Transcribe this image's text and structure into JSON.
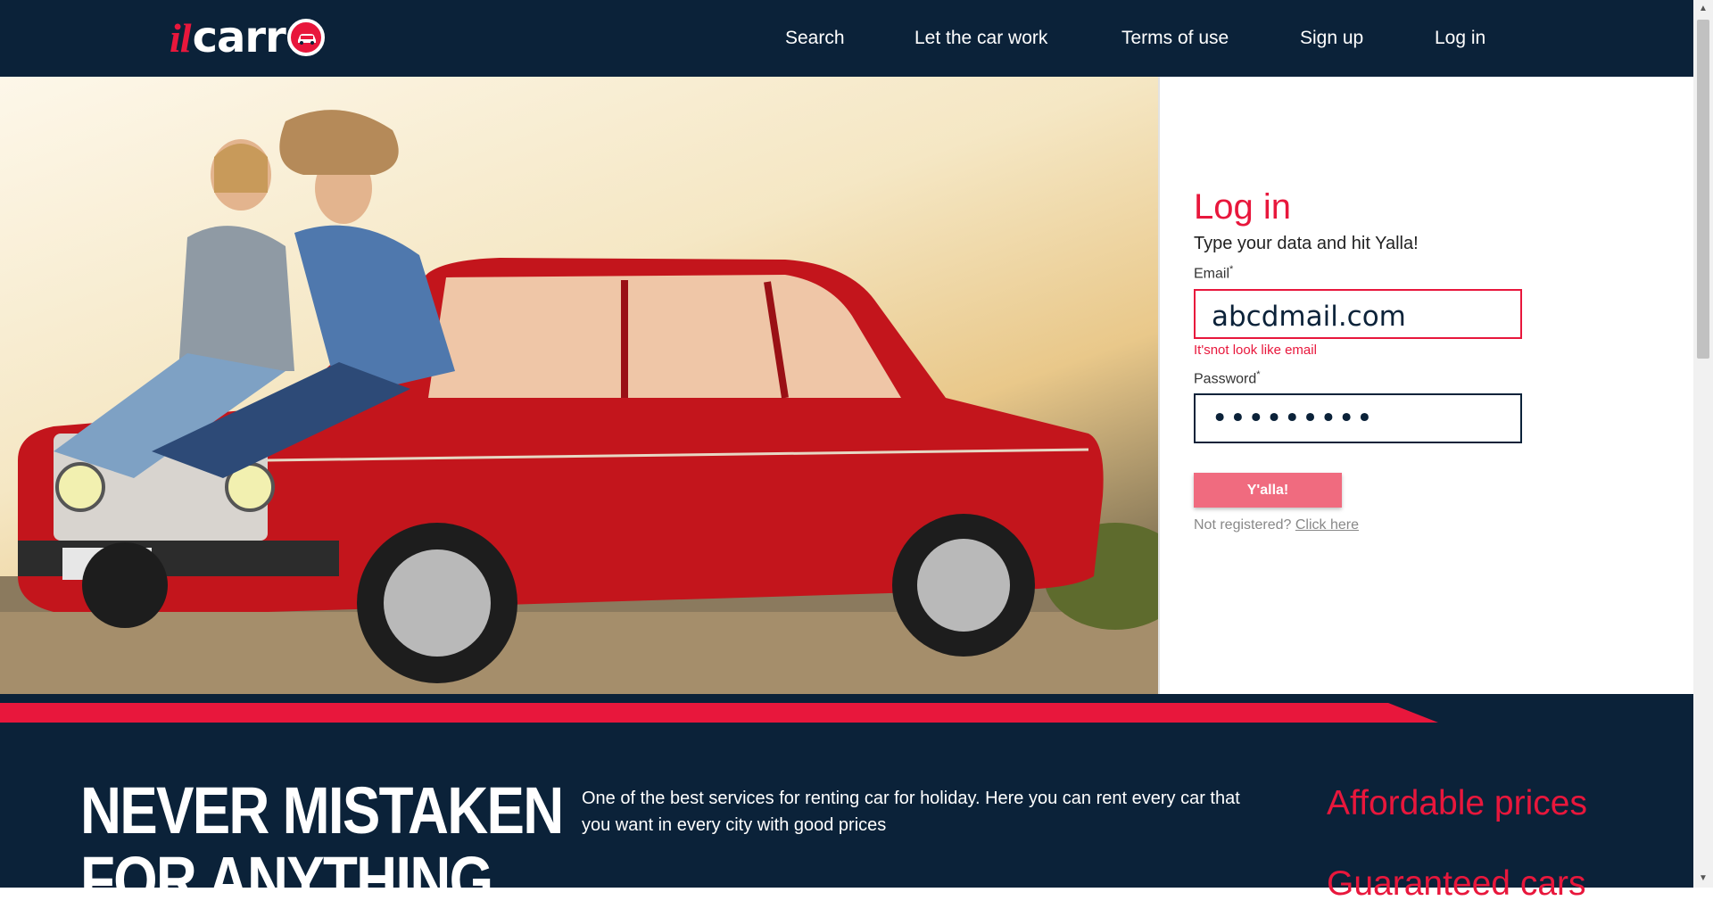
{
  "brand": {
    "logo_il": "il",
    "logo_carr": "carr",
    "accent_color": "#e8173c",
    "navy_color": "#0b2239"
  },
  "nav": {
    "search": "Search",
    "let_the_car_work": "Let the car work",
    "terms_of_use": "Terms of use",
    "sign_up": "Sign up",
    "log_in": "Log in"
  },
  "login": {
    "title": "Log in",
    "subtitle": "Type your data and hit Yalla!",
    "email_label": "Email",
    "email_value": "abcdmail.com",
    "email_error": "It'snot look like email",
    "password_label": "Password",
    "password_value": "•••••••••",
    "submit_label": "Y'alla!",
    "not_registered_text": "Not registered?",
    "click_here_link": "Click here"
  },
  "hero": {
    "image_description_icon": "couple-on-red-car-photo"
  },
  "footer": {
    "slogan_line1": "NEVER MISTAKEN",
    "slogan_line2": "FOR ANYTHING",
    "description": "One of the best services for renting car for holiday. Here you can rent every car that you want in every city with good prices",
    "feature_1": "Affordable prices",
    "feature_2": "Guaranteed cars"
  }
}
